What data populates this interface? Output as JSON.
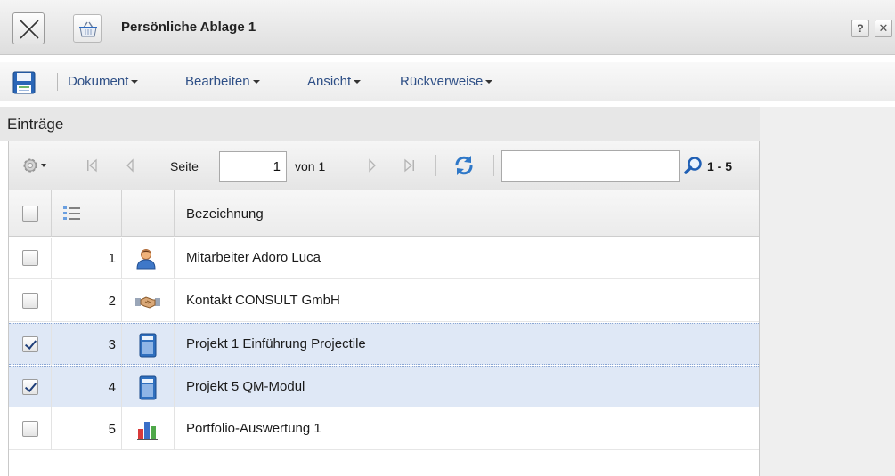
{
  "window": {
    "title": "Persönliche Ablage 1",
    "close_icon": "close-icon",
    "app_icon": "basket-icon",
    "help_label": "?",
    "close_label": "✕"
  },
  "menubar": {
    "save_icon": "floppy-disk-icon",
    "items": [
      {
        "label": "Dokument"
      },
      {
        "label": "Bearbeiten"
      },
      {
        "label": "Ansicht"
      },
      {
        "label": "Rückverweise"
      }
    ]
  },
  "panel": {
    "title": "Einträge"
  },
  "paging": {
    "page_label": "Seite",
    "page_value": "1",
    "of_label": "von 1",
    "search_value": "",
    "range_text": "1 - 5"
  },
  "table": {
    "column_header": "Bezeichnung",
    "rows": [
      {
        "num": "1",
        "icon": "employee-icon",
        "label": "Mitarbeiter Adoro Luca",
        "checked": false
      },
      {
        "num": "2",
        "icon": "handshake-icon",
        "label": "Kontakt CONSULT GmbH",
        "checked": false
      },
      {
        "num": "3",
        "icon": "project-book-icon",
        "label": "Projekt 1 Einführung Projectile",
        "checked": true
      },
      {
        "num": "4",
        "icon": "project-book-icon",
        "label": "Projekt 5 QM-Modul",
        "checked": true
      },
      {
        "num": "5",
        "icon": "bar-chart-icon",
        "label": "Portfolio-Auswertung 1",
        "checked": false
      }
    ]
  },
  "colors": {
    "menu_text": "#2e4f86",
    "selected_row": "#dfe8f6",
    "accent_blue": "#3a73b8"
  }
}
